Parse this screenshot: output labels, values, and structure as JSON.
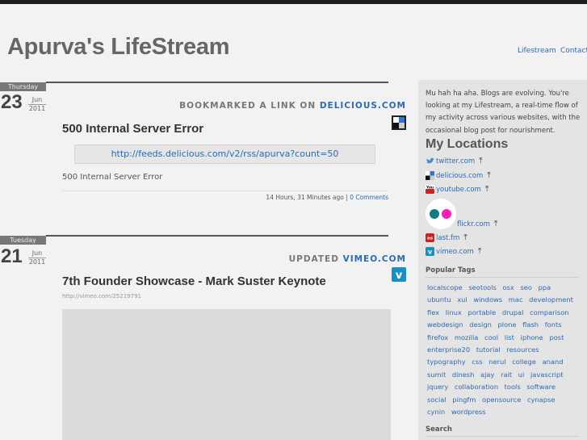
{
  "site": {
    "title": "Apurva's LifeStream"
  },
  "nav": [
    "Lifestream",
    "Contact"
  ],
  "entries": [
    {
      "weekday": "Thursday",
      "day": "23",
      "month": "Jun",
      "year": "2011",
      "action": "BOOKMARKED A LINK ON",
      "service": "DELICIOUS.COM",
      "title": "500 Internal Server Error",
      "link": "http://feeds.delicious.com/v2/rss/apurva?count=50",
      "description": "500 Internal Server Error",
      "time_ago": "14 Hours, 31 Minutes ago |",
      "comments": "0 Comments"
    },
    {
      "weekday": "Tuesday",
      "day": "21",
      "month": "Jun",
      "year": "2011",
      "action": "UPDATED",
      "service": "VIMEO.COM",
      "title": "7th Founder Showcase - Mark Suster Keynote",
      "url": "http://vimeo.com/25219791"
    }
  ],
  "sidebar": {
    "intro": "Mu hah ha aha. Blogs are evolving. You're looking at my Lifestream, a real-time flow of my activity across various websites, with the occasional blog post for nourishment.",
    "locations_heading": "My Locations",
    "locations": [
      {
        "name": "twitter.com",
        "icon": "twitter-icon"
      },
      {
        "name": "delicious.com",
        "icon": "delicious-icon"
      },
      {
        "name": "youtube.com",
        "icon": "youtube-icon"
      },
      {
        "name": "flickr.com",
        "icon": "flickr-icon"
      },
      {
        "name": "last.fm",
        "icon": "lastfm-icon"
      },
      {
        "name": "vimeo.com",
        "icon": "vimeo-icon"
      }
    ],
    "arrow": "⤒",
    "tags_heading": "Popular Tags",
    "tags": [
      "localscope",
      "seotools",
      "osx",
      "seo",
      "ppa",
      "ubuntu",
      "xul",
      "windows",
      "mac",
      "development",
      "flex",
      "linux",
      "portable",
      "drupal",
      "comparison",
      "webdesign",
      "design",
      "plone",
      "flash",
      "fonts",
      "firefox",
      "mozilla",
      "cool",
      "list",
      "iphone",
      "post",
      "enterprise20",
      "tutorial",
      "resources",
      "typography",
      "css",
      "nerul",
      "college",
      "anand",
      "sumit",
      "dinesh",
      "ajay",
      "rait",
      "ui",
      "javascript",
      "jquery",
      "collaboration",
      "tools",
      "software",
      "social",
      "pingfm",
      "opensource",
      "cynapse",
      "cynin",
      "wordpress"
    ],
    "search_heading": "Search"
  },
  "colors": {
    "link": "#2a6ab8",
    "sidebar_bg": "#e4e4e4",
    "page_bg": "#f2f2f2",
    "twitter": "#3a8fd6",
    "youtube": "#cc2222",
    "lastfm": "#d11f1f",
    "vimeo": "#1a8fc4",
    "flickr_blue": "#137a7f",
    "flickr_pink": "#ff1fb8"
  }
}
